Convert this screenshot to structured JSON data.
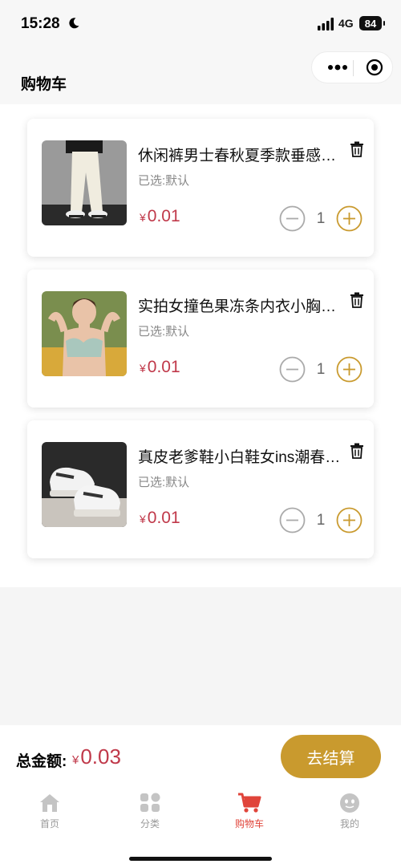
{
  "status_bar": {
    "time": "15:28",
    "network": "4G",
    "battery": "84"
  },
  "nav": {
    "title": "购物车",
    "icons": [
      "more-icon",
      "close-target-icon"
    ]
  },
  "cart": {
    "items": [
      {
        "title": "休闲裤男士春秋夏季款垂感宽松直筒长裤",
        "spec": "已选:默认",
        "currency": "¥",
        "price": "0.01",
        "quantity": "1",
        "icon": "trash-icon"
      },
      {
        "title": "实拍女撞色果冻条内衣小胸聚拢无痕文胸",
        "spec": "已选:默认",
        "currency": "¥",
        "price": "0.01",
        "quantity": "1",
        "icon": "trash-icon"
      },
      {
        "title": "真皮老爹鞋小白鞋女ins潮春秋新款厚底",
        "spec": "已选:默认",
        "currency": "¥",
        "price": "0.01",
        "quantity": "1",
        "icon": "trash-icon"
      }
    ]
  },
  "checkout": {
    "total_label": "总金额:",
    "currency": "¥",
    "total": "0.03",
    "button_label": "去结算"
  },
  "tabs": [
    {
      "label": "首页",
      "icon": "home-icon",
      "active": false
    },
    {
      "label": "分类",
      "icon": "category-icon",
      "active": false
    },
    {
      "label": "购物车",
      "icon": "cart-icon",
      "active": true
    },
    {
      "label": "我的",
      "icon": "profile-icon",
      "active": false
    }
  ],
  "colors": {
    "price": "#c0394a",
    "accent_gold": "#c99a2e",
    "tab_active": "#e0443a",
    "tab_inactive": "#999999"
  }
}
